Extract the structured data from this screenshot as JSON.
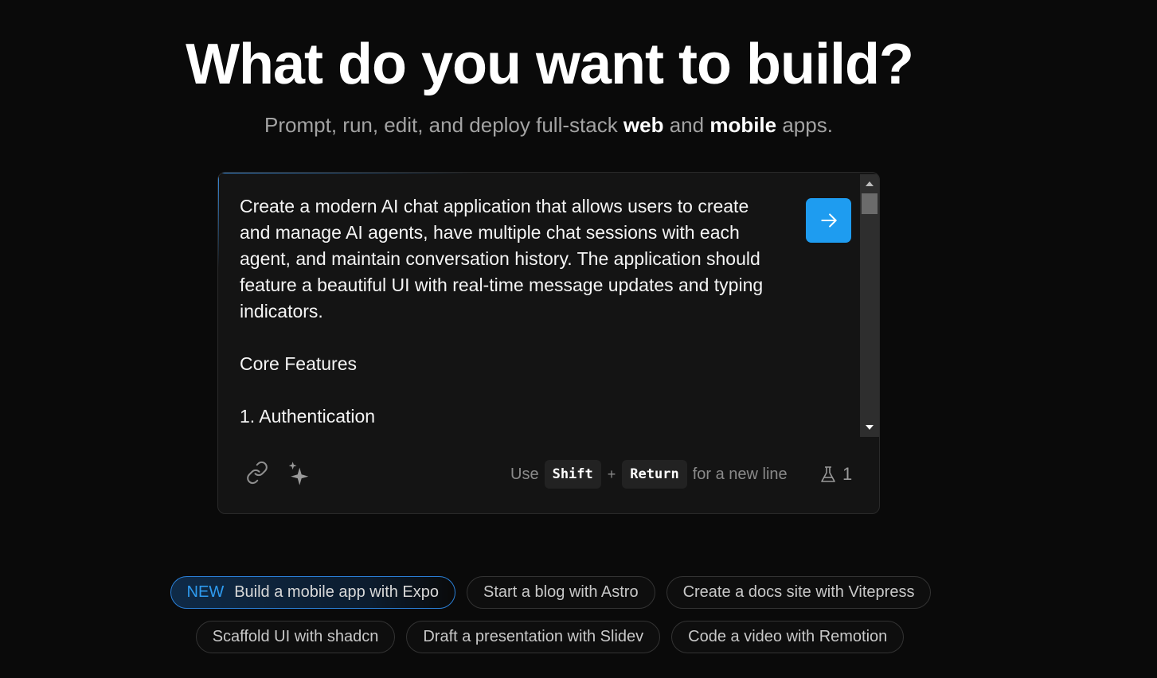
{
  "hero": {
    "title": "What do you want to build?",
    "subtitle_prefix": "Prompt, run, edit, and deploy full-stack ",
    "subtitle_web": "web",
    "subtitle_and": " and ",
    "subtitle_mobile": "mobile",
    "subtitle_suffix": " apps."
  },
  "prompt": {
    "text": "Create a modern AI chat application that allows users to create and manage AI agents, have multiple chat sessions with each agent, and maintain conversation history. The application should feature a beautiful UI with real-time message updates and typing indicators.\n\nCore Features\n\n1. Authentication"
  },
  "toolbar": {
    "hint_use": "Use",
    "key_shift": "Shift",
    "key_plus": "+",
    "key_return": "Return",
    "hint_tail": "for a new line",
    "counter_value": "1"
  },
  "suggestions": {
    "row1": [
      {
        "badge": "NEW",
        "label": "Build a mobile app with Expo"
      },
      {
        "label": "Start a blog with Astro"
      },
      {
        "label": "Create a docs site with Vitepress"
      }
    ],
    "row2": [
      {
        "label": "Scaffold UI with shadcn"
      },
      {
        "label": "Draft a presentation with Slidev"
      },
      {
        "label": "Code a video with Remotion"
      }
    ]
  },
  "colors": {
    "background": "#0a0a0a",
    "accent": "#1e9cf0",
    "badge": "#2e9bf0"
  },
  "icons": {
    "send": "arrow-right-icon",
    "attach": "link-icon",
    "enhance": "sparkle-icon",
    "counter": "flask-icon"
  }
}
